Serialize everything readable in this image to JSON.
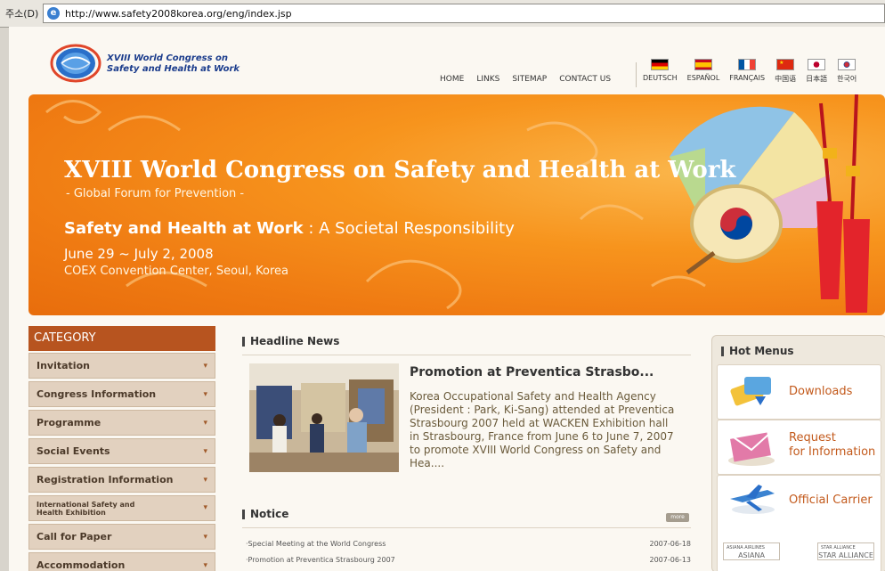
{
  "browser": {
    "address_label": "주소(D)",
    "url": "http://www.safety2008korea.org/eng/index.jsp"
  },
  "logo": {
    "line1": "XVIII World Congress on",
    "line2": "Safety and Health at Work"
  },
  "topnav": [
    "HOME",
    "LINKS",
    "SITEMAP",
    "CONTACT US"
  ],
  "languages": [
    "DEUTSCH",
    "ESPAÑOL",
    "FRANÇAIS",
    "中国语",
    "日本語",
    "한국어"
  ],
  "banner": {
    "title": "XVIII World Congress on Safety and Health at Work",
    "subtitle": "- Global Forum for Prevention -",
    "theme_bold": "Safety and Health at Work",
    "theme_rest": " : A Societal Responsibility",
    "dates": "June 29 ~ July 2, 2008",
    "venue": "COEX Convention Center, Seoul, Korea"
  },
  "category": {
    "header": "CATEGORY",
    "items": [
      "Invitation",
      "Congress Information",
      "Programme",
      "Social Events",
      "Registration Information",
      "International Safety and Health Exhibition",
      "Call for Paper",
      "Accommodation"
    ]
  },
  "headline": {
    "header": "Headline News",
    "title": "Promotion at Preventica Strasbo...",
    "body": "Korea Occupational Safety and Health Agency (President : Park, Ki-Sang) attended at Preventica Strasbourg 2007 held at WACKEN Exhibition hall in Strasbourg, France from June 6 to June 7, 2007 to promote XVIII World Congress on Safety and Hea...."
  },
  "notice": {
    "header": "Notice",
    "more": "more",
    "rows": [
      {
        "title": "·Special Meeting at the World Congress",
        "date": "2007-06-18"
      },
      {
        "title": "·Promotion at Preventica Strasbourg 2007",
        "date": "2007-06-13"
      }
    ]
  },
  "hot_menus": {
    "header": "Hot Menus",
    "downloads": "Downloads",
    "request_1": "Request",
    "request_2": "for Information",
    "carrier": "Official Carrier",
    "asiana_top": "ASIANA AIRLINES",
    "asiana": "ASIANA",
    "star_top": "STAR ALLIANCE",
    "star": "STAR ALLIANCE"
  },
  "colors": {
    "banner_orange": "#f7941d",
    "category_header": "#b7541f",
    "link_orange": "#c35a1c"
  }
}
